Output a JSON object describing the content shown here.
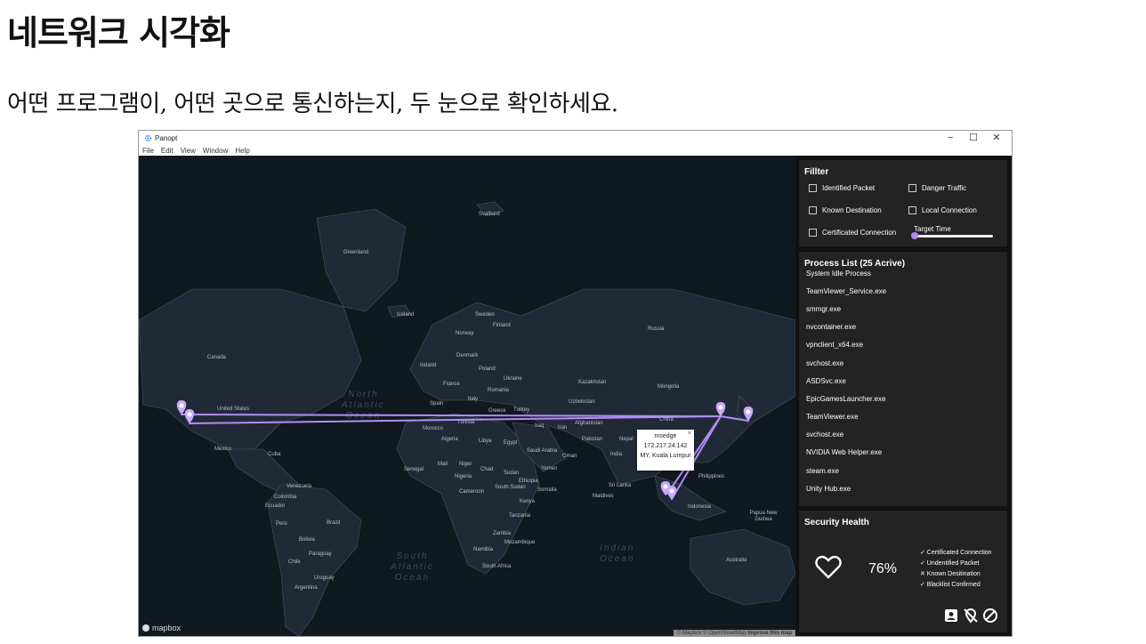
{
  "slide": {
    "title": "네트워크 시각화",
    "subtitle": "어떤 프로그램이, 어떤 곳으로 통신하는지, 두 눈으로 확인하세요."
  },
  "window": {
    "title": "Panopt",
    "controls": [
      "−",
      "☐",
      "✕"
    ],
    "menu": [
      "File",
      "Edit",
      "View",
      "Window",
      "Help"
    ]
  },
  "map": {
    "countries": [
      "Svalbard",
      "Greenland",
      "Iceland",
      "Sweden",
      "Finland",
      "Norway",
      "Russia",
      "Canada",
      "Denmark",
      "Ireland",
      "Poland",
      "Ukraine",
      "Kazakhstan",
      "France",
      "Romania",
      "Mongolia",
      "United States",
      "Spain",
      "Italy",
      "Greece",
      "Turkey",
      "Uzbekistan",
      "China",
      "Morocco",
      "Tunisia",
      "Iraq",
      "Iran",
      "Afghanistan",
      "Algeria",
      "Libya",
      "Egypt",
      "Pakistan",
      "Nepal",
      "Mexico",
      "Cuba",
      "Saudi Arabia",
      "Oman",
      "India",
      "Mali",
      "Niger",
      "Senegal",
      "Chad",
      "Sudan",
      "Yemen",
      "Nigeria",
      "Ethiopia",
      "Venezuela",
      "Colombia",
      "Cameroon",
      "South Sudan",
      "Somalia",
      "Sri Lanka",
      "Maldives",
      "Philippines",
      "Ecuador",
      "Kenya",
      "Tanzania",
      "Indonesia",
      "Peru",
      "Brazil",
      "Papua New Guinea",
      "Zambia",
      "Bolivia",
      "Mozambique",
      "Namibia",
      "Paraguay",
      "Chile",
      "South Africa",
      "Australia",
      "Uruguay",
      "Argentina"
    ],
    "oceans": {
      "north_atlantic": [
        "North",
        "Atlantic",
        "Ocean"
      ],
      "south_atlantic": [
        "South",
        "Atlantic",
        "Ocean"
      ],
      "indian": [
        "Indian",
        "Ocean"
      ]
    },
    "popup": {
      "process": "msedge",
      "ip": "172.217.24.142",
      "location": "MY, Kuala Lumpur",
      "close": "×"
    },
    "logo": "mapbox",
    "attribution": "© Mapbox © OpenStreetMap",
    "attribution_link": "Improve this map",
    "connection_color": "#b38cf7",
    "markers": [
      "map-pin-icon",
      "map-pin-icon",
      "map-pin-icon",
      "map-pin-icon",
      "map-pin-icon",
      "map-pin-icon"
    ]
  },
  "filter": {
    "title": "Fillter",
    "options": [
      "Identified Packet",
      "Danger Traffic",
      "Known Destination",
      "Local Connection",
      "Certificated Connection"
    ],
    "target_time_label": "Target Time"
  },
  "process_list": {
    "title": "Process List (25 Acrive)",
    "items": [
      "System Idle Process",
      "TeamViewer_Service.exe",
      "smmgr.exe",
      "nvcontainer.exe",
      "vpnclient_x64.exe",
      "svchost.exe",
      "ASDSvc.exe",
      "EpicGamesLauncher.exe",
      "TeamViewer.exe",
      "svchost.exe",
      "NVIDIA Web Helper.exe",
      "steam.exe",
      "Unity Hub.exe"
    ]
  },
  "security": {
    "title": "Security Health",
    "score": "76%",
    "checks": [
      "✓ Certificated Connection",
      "✓ Undentified Packet",
      "✕ Known Desitination",
      "✓ Blacklist Confirmed"
    ],
    "icons": [
      "contact-card-icon",
      "location-off-icon",
      "block-icon"
    ]
  }
}
